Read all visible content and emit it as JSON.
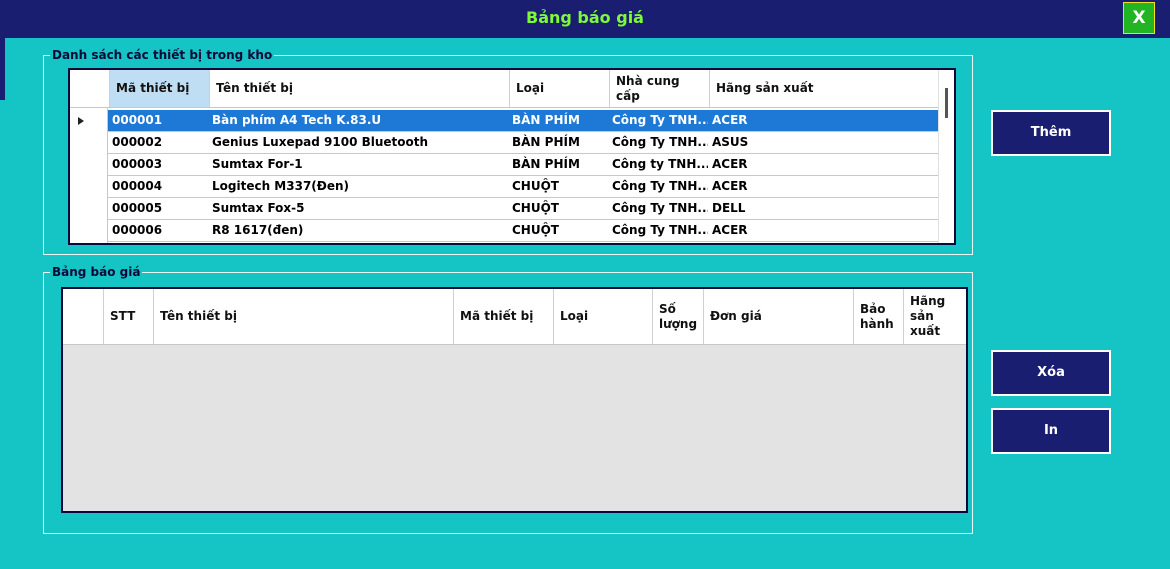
{
  "window": {
    "title": "Bảng báo giá",
    "close_label": "X"
  },
  "inventory": {
    "group_label": "Danh sách các thiết bị trong kho",
    "columns": [
      "Mã thiết bị",
      "Tên thiết bị",
      "Loại",
      "Nhà cung cấp",
      "Hãng sản xuất"
    ],
    "rows": [
      [
        "000001",
        "Bàn phím A4 Tech K.83.U",
        "BÀN PHÍM",
        "Công Ty TNH...",
        "ACER"
      ],
      [
        "000002",
        "Genius Luxepad 9100 Bluetooth",
        "BÀN PHÍM",
        "Công Ty TNH...",
        "ASUS"
      ],
      [
        "000003",
        "Sumtax For-1",
        "BÀN PHÍM",
        "Công ty TNH...",
        "ACER"
      ],
      [
        "000004",
        "Logitech M337(Đen)",
        "CHUỘT",
        "Công Ty TNH...",
        "ACER"
      ],
      [
        "000005",
        "Sumtax Fox-5",
        "CHUỘT",
        "Công Ty TNH...",
        "DELL"
      ],
      [
        "000006",
        "R8 1617(đen)",
        "CHUỘT",
        "Công Ty TNH...",
        "ACER"
      ]
    ],
    "selected_row": 0
  },
  "quote": {
    "group_label": "Bảng báo giá",
    "columns": [
      "STT",
      "Tên thiết bị",
      "Mã thiết bị",
      "Loại",
      "Số lượng",
      "Đơn giá",
      "Bảo hành",
      "Hãng sản xuất"
    ]
  },
  "buttons": {
    "add": "Thêm",
    "delete": "Xóa",
    "print": "In"
  },
  "colors": {
    "background": "#15C4C4",
    "titlebar": "#1A1E70",
    "title_text": "#7CFC32",
    "selection": "#1E78D6",
    "close_button": "#22B422"
  }
}
